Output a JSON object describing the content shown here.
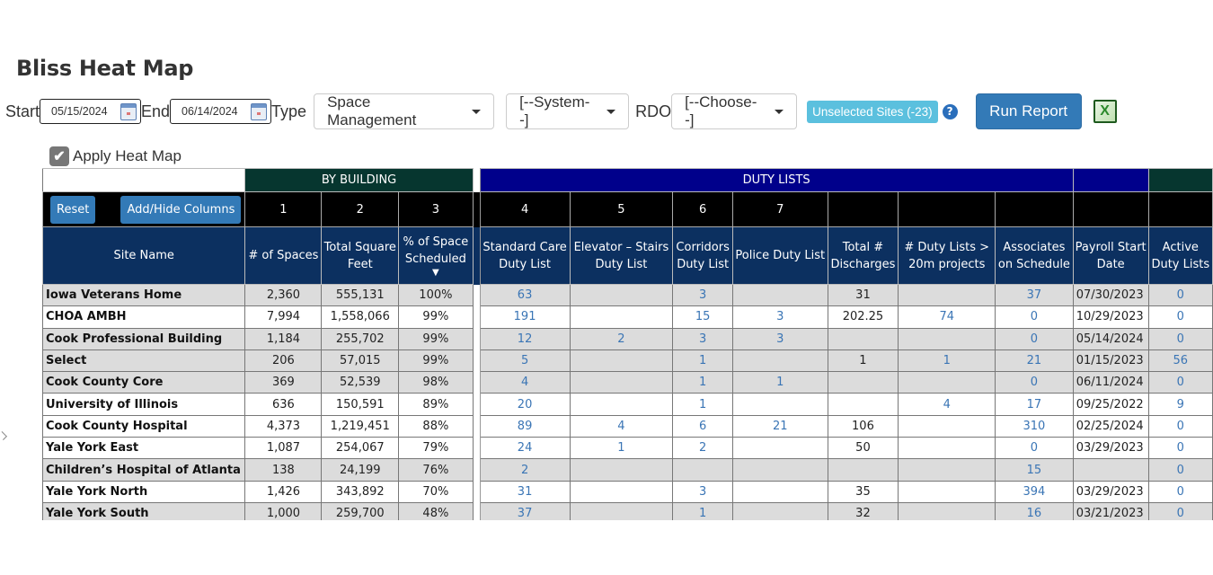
{
  "page": {
    "title": "Bliss Heat Map"
  },
  "filters": {
    "start_label": "Start",
    "start_value": "05/15/2024",
    "end_label": "End",
    "end_value": "06/14/2024",
    "type_label": "Type",
    "type_value": "Space Management",
    "system_value": "[--System--]",
    "rdo_label": "RDO",
    "rdo_value": "[--Choose--]",
    "unselected_badge": "Unselected Sites (-23)",
    "help_icon": "?",
    "run_label": "Run Report",
    "excel_icon": "X"
  },
  "heat_map": {
    "label": "Apply Heat Map",
    "checked": true,
    "check_glyph": "✔"
  },
  "table": {
    "group_by_building": "BY BUILDING",
    "group_duty_lists": "DUTY LISTS",
    "reset_label": "Reset",
    "add_hide_label": "Add/Hide Columns",
    "col_numbers": [
      "1",
      "2",
      "3",
      "4",
      "5",
      "6",
      "7"
    ],
    "sort_glyph": "▼",
    "columns": [
      "Site Name",
      "# of Spaces",
      "Total Square Feet",
      "% of Space Scheduled",
      "Standard Care Duty List",
      "Elevator – Stairs Duty List",
      "Corridors Duty List",
      "Police Duty List",
      "Total # Discharges",
      "# Duty Lists > 20m projects",
      "Associates on Schedule",
      "Payroll Start Date",
      "Active Duty Lists"
    ],
    "rows": [
      {
        "site": "Iowa Veterans Home",
        "spaces": "2,360",
        "sqft": "555,131",
        "pct": "100%",
        "std": "63",
        "elev": "",
        "corr": "3",
        "police": "",
        "disch": "31",
        "dl20": "",
        "assoc": "37",
        "payroll": "07/30/2023",
        "active": "0",
        "shade": "g"
      },
      {
        "site": "CHOA AMBH",
        "spaces": "7,994",
        "sqft": "1,558,066",
        "pct": "99%",
        "std": "191",
        "elev": "",
        "corr": "15",
        "police": "3",
        "disch": "202.25",
        "dl20": "74",
        "assoc": "0",
        "payroll": "10/29/2023",
        "active": "0",
        "shade": "w"
      },
      {
        "site": "Cook Professional Building",
        "spaces": "1,184",
        "sqft": "255,702",
        "pct": "99%",
        "std": "12",
        "elev": "2",
        "corr": "3",
        "police": "3",
        "disch": "",
        "dl20": "",
        "assoc": "0",
        "payroll": "05/14/2024",
        "active": "0",
        "shade": "g"
      },
      {
        "site": "Select",
        "spaces": "206",
        "sqft": "57,015",
        "pct": "99%",
        "std": "5",
        "elev": "",
        "corr": "1",
        "police": "",
        "disch": "1",
        "dl20": "1",
        "assoc": "21",
        "payroll": "01/15/2023",
        "active": "56",
        "shade": "g"
      },
      {
        "site": "Cook County Core",
        "spaces": "369",
        "sqft": "52,539",
        "pct": "98%",
        "std": "4",
        "elev": "",
        "corr": "1",
        "police": "1",
        "disch": "",
        "dl20": "",
        "assoc": "0",
        "payroll": "06/11/2024",
        "active": "0",
        "shade": "g"
      },
      {
        "site": "University of Illinois",
        "spaces": "636",
        "sqft": "150,591",
        "pct": "89%",
        "std": "20",
        "elev": "",
        "corr": "1",
        "police": "",
        "disch": "",
        "dl20": "4",
        "assoc": "17",
        "payroll": "09/25/2022",
        "active": "9",
        "shade": "w"
      },
      {
        "site": "Cook County Hospital",
        "spaces": "4,373",
        "sqft": "1,219,451",
        "pct": "88%",
        "std": "89",
        "elev": "4",
        "corr": "6",
        "police": "21",
        "disch": "106",
        "dl20": "",
        "assoc": "310",
        "payroll": "02/25/2024",
        "active": "0",
        "shade": "w"
      },
      {
        "site": "Yale York East",
        "spaces": "1,087",
        "sqft": "254,067",
        "pct": "79%",
        "std": "24",
        "elev": "1",
        "corr": "2",
        "police": "",
        "disch": "50",
        "dl20": "",
        "assoc": "0",
        "payroll": "03/29/2023",
        "active": "0",
        "shade": "w"
      },
      {
        "site": "Children’s Hospital of Atlanta",
        "spaces": "138",
        "sqft": "24,199",
        "pct": "76%",
        "std": "2",
        "elev": "",
        "corr": "",
        "police": "",
        "disch": "",
        "dl20": "",
        "assoc": "15",
        "payroll": "",
        "active": "0",
        "shade": "g"
      },
      {
        "site": "Yale York North",
        "spaces": "1,426",
        "sqft": "343,892",
        "pct": "70%",
        "std": "31",
        "elev": "",
        "corr": "3",
        "police": "",
        "disch": "35",
        "dl20": "",
        "assoc": "394",
        "payroll": "03/29/2023",
        "active": "0",
        "shade": "w"
      },
      {
        "site": "Yale York South",
        "spaces": "1,000",
        "sqft": "259,700",
        "pct": "48%",
        "std": "37",
        "elev": "",
        "corr": "1",
        "police": "",
        "disch": "32",
        "dl20": "",
        "assoc": "16",
        "payroll": "03/21/2023",
        "active": "0",
        "shade": "g"
      }
    ]
  }
}
